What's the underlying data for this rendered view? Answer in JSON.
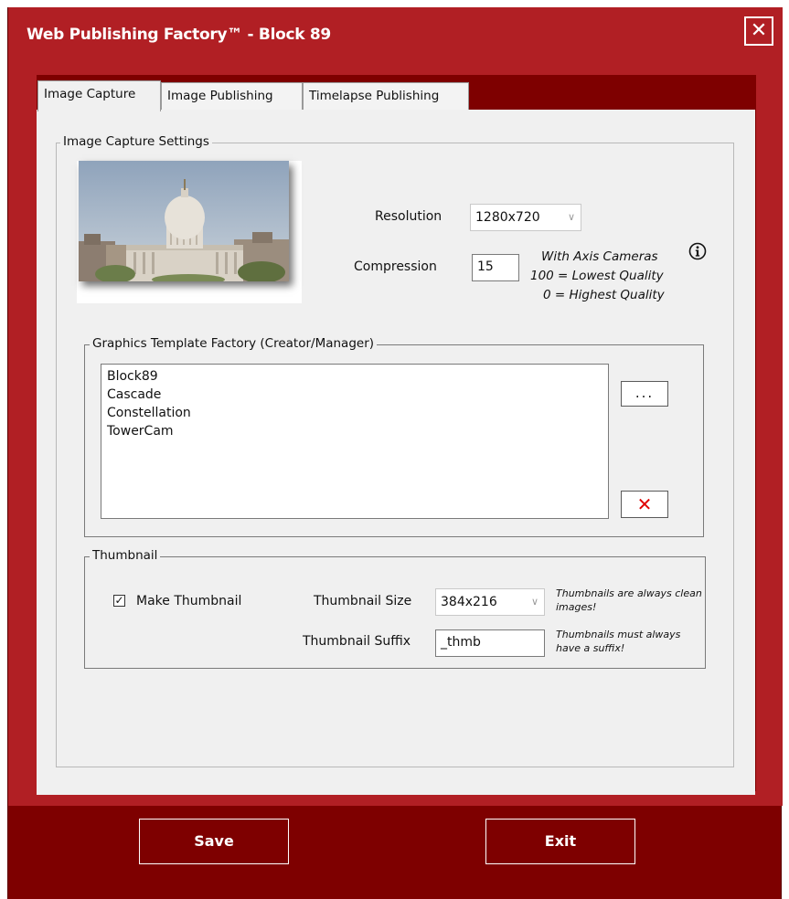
{
  "window": {
    "title": "Web Publishing Factory™ - Block 89",
    "close_label": "✕"
  },
  "tabs": [
    {
      "label": "Image Capture",
      "active": true
    },
    {
      "label": "Image Publishing",
      "active": false
    },
    {
      "label": "Timelapse Publishing",
      "active": false
    }
  ],
  "capture": {
    "group_label": "Image Capture Settings",
    "resolution_label": "Resolution",
    "resolution_value": "1280x720",
    "compression_label": "Compression",
    "compression_value": "15",
    "hint_line1": "With Axis Cameras",
    "hint_line2": "100 = Lowest Quality",
    "hint_line3": "0 = Highest Quality"
  },
  "templates": {
    "group_label": "Graphics Template Factory (Creator/Manager)",
    "items": [
      "Block89",
      "Cascade",
      "Constellation",
      "TowerCam"
    ],
    "browse_label": "...",
    "delete_label": "✕"
  },
  "thumbnail": {
    "group_label": "Thumbnail",
    "make_label": "Make Thumbnail",
    "make_checked": true,
    "size_label": "Thumbnail Size",
    "size_value": "384x216",
    "size_hint": "Thumbnails are always clean images!",
    "suffix_label": "Thumbnail Suffix",
    "suffix_value": "_thmb",
    "suffix_hint": "Thumbnails must always have a suffix!"
  },
  "footer": {
    "save_label": "Save",
    "exit_label": "Exit"
  },
  "colors": {
    "frame": "#b11f24",
    "frame_dark": "#7e0000",
    "delete_x": "#e00000"
  }
}
